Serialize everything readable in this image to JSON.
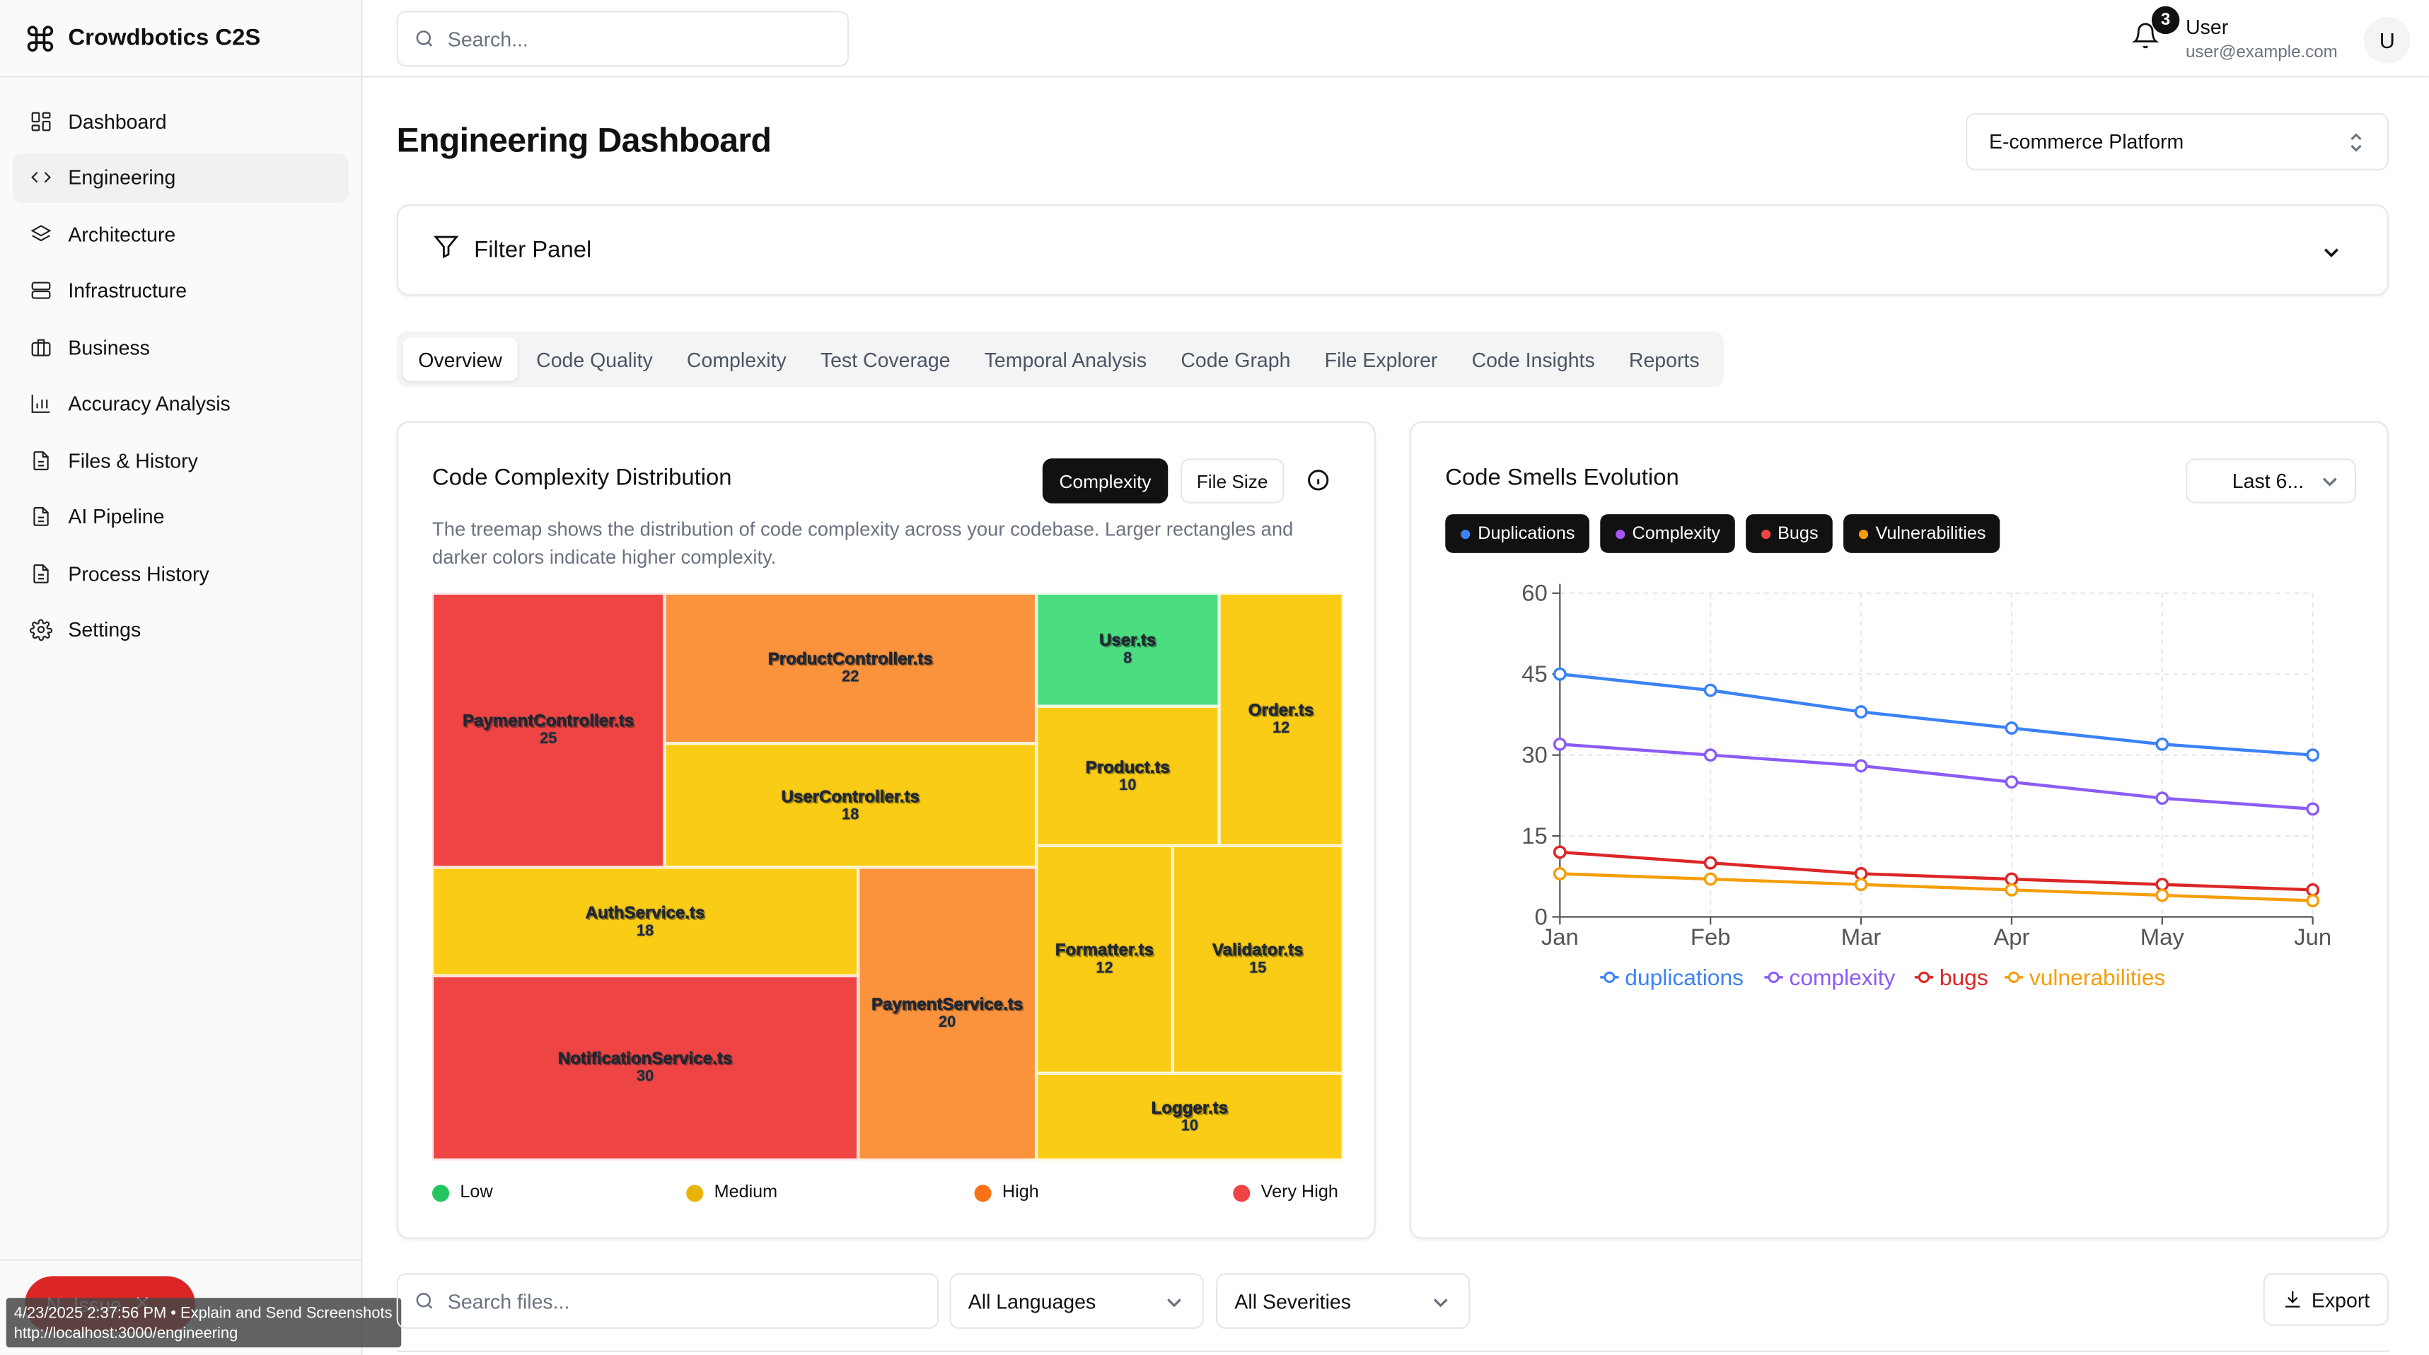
{
  "app": {
    "name": "Crowdbotics C2S"
  },
  "topbar": {
    "search_placeholder": "Search...",
    "notification_count": "3",
    "user_name": "User",
    "user_email": "user@example.com",
    "avatar_initial": "U"
  },
  "sidebar": {
    "items": [
      {
        "label": "Dashboard",
        "icon": "grid-icon"
      },
      {
        "label": "Engineering",
        "icon": "code-icon",
        "active": true
      },
      {
        "label": "Architecture",
        "icon": "layers-icon"
      },
      {
        "label": "Infrastructure",
        "icon": "server-icon"
      },
      {
        "label": "Business",
        "icon": "briefcase-icon"
      },
      {
        "label": "Accuracy Analysis",
        "icon": "bar-chart-icon"
      },
      {
        "label": "Files & History",
        "icon": "file-icon"
      },
      {
        "label": "AI Pipeline",
        "icon": "file-icon"
      },
      {
        "label": "Process History",
        "icon": "file-icon"
      },
      {
        "label": "Settings",
        "icon": "gear-icon"
      }
    ],
    "issue_button": "Issue",
    "toast_line1": "4/23/2025 2:37:56 PM • Explain and Send Screenshots",
    "toast_line2": "http://localhost:3000/engineering"
  },
  "main": {
    "title": "Engineering Dashboard",
    "project": "E-commerce Platform",
    "filter_panel": "Filter Panel",
    "tabs": [
      "Overview",
      "Code Quality",
      "Complexity",
      "Test Coverage",
      "Temporal Analysis",
      "Code Graph",
      "File Explorer",
      "Code Insights",
      "Reports"
    ],
    "active_tab": "Overview"
  },
  "complexity_card": {
    "title": "Code Complexity Distribution",
    "btn_complexity": "Complexity",
    "btn_file_size": "File Size",
    "description": "The treemap shows the distribution of code complexity across your codebase. Larger rectangles and darker colors indicate higher complexity.",
    "tiles": [
      {
        "name": "PaymentController.ts",
        "value": "25",
        "level": "very_high"
      },
      {
        "name": "ProductController.ts",
        "value": "22",
        "level": "high"
      },
      {
        "name": "UserController.ts",
        "value": "18",
        "level": "medium"
      },
      {
        "name": "AuthService.ts",
        "value": "18",
        "level": "medium"
      },
      {
        "name": "NotificationService.ts",
        "value": "30",
        "level": "very_high"
      },
      {
        "name": "PaymentService.ts",
        "value": "20",
        "level": "high"
      },
      {
        "name": "User.ts",
        "value": "8",
        "level": "low"
      },
      {
        "name": "Product.ts",
        "value": "10",
        "level": "medium"
      },
      {
        "name": "Order.ts",
        "value": "12",
        "level": "medium"
      },
      {
        "name": "Formatter.ts",
        "value": "12",
        "level": "medium"
      },
      {
        "name": "Validator.ts",
        "value": "15",
        "level": "medium"
      },
      {
        "name": "Logger.ts",
        "value": "10",
        "level": "medium"
      }
    ],
    "legend": [
      {
        "label": "Low",
        "color": "#22c55e"
      },
      {
        "label": "Medium",
        "color": "#eab308"
      },
      {
        "label": "High",
        "color": "#f97316"
      },
      {
        "label": "Very High",
        "color": "#ef4444"
      }
    ],
    "colors": {
      "low": "#4ade80",
      "medium": "#facc15",
      "high": "#fb923c",
      "very_high": "#ef4444"
    }
  },
  "smells_card": {
    "title": "Code Smells Evolution",
    "range": "Last 6...",
    "chips": [
      {
        "label": "Duplications",
        "color": "#3b82f6"
      },
      {
        "label": "Complexity",
        "color": "#a855f7"
      },
      {
        "label": "Bugs",
        "color": "#ef4444"
      },
      {
        "label": "Vulnerabilities",
        "color": "#f59e0b"
      }
    ]
  },
  "chart_data": {
    "type": "line",
    "x": [
      "Jan",
      "Feb",
      "Mar",
      "Apr",
      "May",
      "Jun"
    ],
    "ylim": [
      0,
      60
    ],
    "yticks": [
      "0",
      "15",
      "30",
      "45",
      "60"
    ],
    "grid": true,
    "legend_position": "bottom",
    "series": [
      {
        "name": "duplications",
        "color": "#3b82f6",
        "values": [
          45,
          42,
          38,
          35,
          32,
          30
        ]
      },
      {
        "name": "complexity",
        "color": "#8b5cf6",
        "values": [
          32,
          30,
          28,
          25,
          22,
          20
        ]
      },
      {
        "name": "bugs",
        "color": "#dc2626",
        "values": [
          12,
          10,
          8,
          7,
          6,
          5
        ]
      },
      {
        "name": "vulnerabilities",
        "color": "#f59e0b",
        "values": [
          8,
          7,
          6,
          5,
          4,
          3
        ]
      }
    ]
  },
  "bottom": {
    "file_search_placeholder": "Search files...",
    "languages": "All Languages",
    "severities": "All Severities",
    "export": "Export"
  }
}
